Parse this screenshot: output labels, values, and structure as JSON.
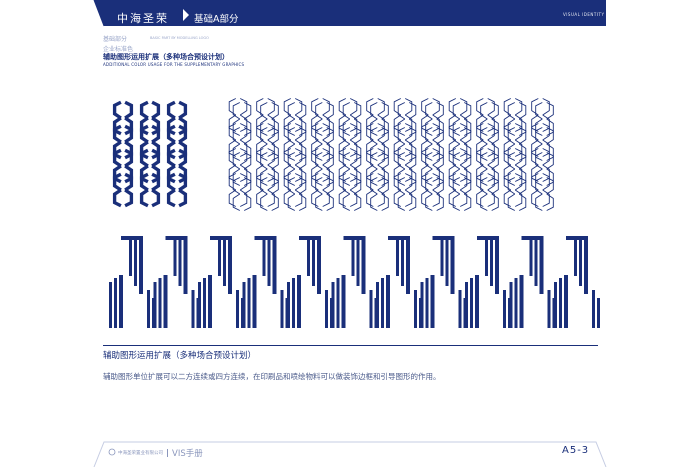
{
  "header": {
    "company": "中海圣荣",
    "section": "基础A部分",
    "right_label": "VISUAL IDENTITY SYSTEM",
    "brand_color": "#1a2f7a"
  },
  "subheader": {
    "section_label": "基础部分",
    "section_label_en": "BASIC PART BY MODELLING LOGO",
    "category": "企业标准色"
  },
  "page": {
    "heading": "辅助图形运用扩展（多种场合预设计划）",
    "heading_en": "ADDITIONAL COLOR USAGE FOR THE SUPPLEMENTARY GRAPHICS"
  },
  "caption": {
    "title": "辅助图形运用扩展（多种场合预设计划）",
    "body": "辅助图形单位扩展可以二方连续或四方连续，在印刷品和喷绘物料可以做装饰边框和引导图形的作用。"
  },
  "footer": {
    "company": "中海圣荣置业有限公司",
    "manual": "VIS手册",
    "page_number": "A5-3"
  },
  "icons": {
    "hex_pattern": "hexagon-chain-pattern-icon",
    "bar_pattern": "vertical-bar-pattern-icon"
  }
}
